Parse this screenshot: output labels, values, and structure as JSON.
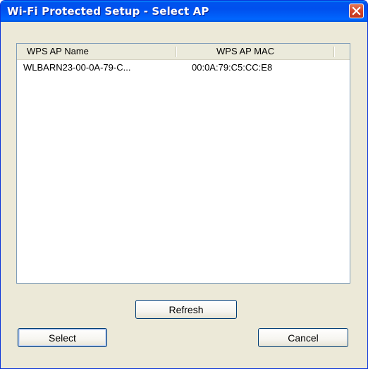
{
  "window": {
    "title": "Wi-Fi Protected Setup - Select AP"
  },
  "list": {
    "columns": [
      "WPS AP Name",
      "WPS AP MAC"
    ],
    "rows": [
      {
        "name": "WLBARN23-00-0A-79-C...",
        "mac": "00:0A:79:C5:CC:E8"
      }
    ]
  },
  "buttons": {
    "refresh": "Refresh",
    "select": "Select",
    "cancel": "Cancel"
  },
  "colors": {
    "titlebar": "#0053ee",
    "close_button": "#d6462b",
    "dialog_background": "#ece9d8"
  },
  "icons": {
    "close": "close-icon"
  }
}
